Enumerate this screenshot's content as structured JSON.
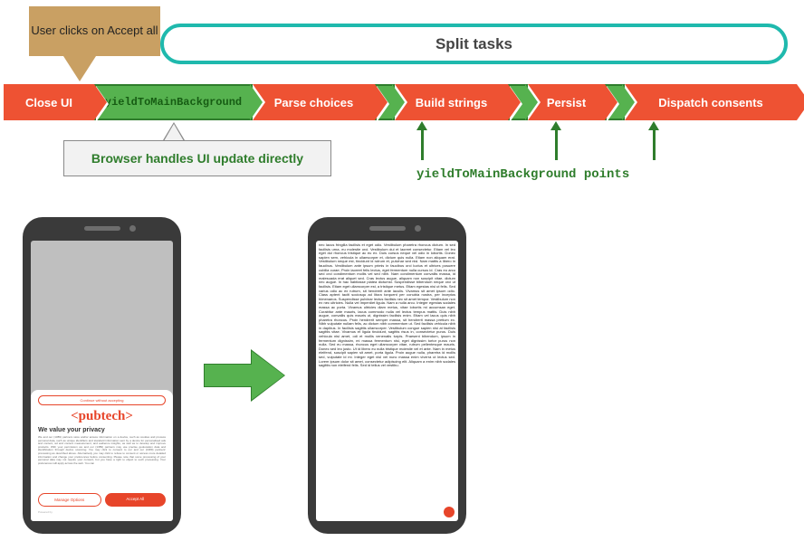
{
  "callout": {
    "text": "User clicks on Accept all"
  },
  "split_pill": "Split tasks",
  "tasks": {
    "close_ui": "Close UI",
    "yield_main_bg": "yieldToMainBackground",
    "parse": "Parse choices",
    "build": "Build strings",
    "persist": "Persist",
    "dispatch": "Dispatch consents"
  },
  "hint": "Browser handles UI update directly",
  "yield_points_label": "yieldToMainBackground points",
  "cmp": {
    "top_banner": "Continue without accepting",
    "logo": "<pubtech>",
    "title": "We value your privacy",
    "body": "We and our (1389) partners store and/or access information on a device, such as cookies and process personal data, such as unique identifiers and standard information sent by a device for personalised ads and content, ad and content measurement, and audience insights, as well as to develop and improve products. With your permission we and our (1389) partners may use precise geolocation data and identification through device scanning. You may click to consent to our and our (1389) partners' processing as described above. Alternatively you may click to refuse to consent or access more detailed information and change your preferences before consenting. Please note that some processing of your personal data may not require your consent, but you have a right to object to such processing. Your preferences will apply across the web. You can",
    "manage_btn": "Manage Options",
    "accept_btn": "Accept All",
    "powered": "Powered by"
  },
  "lorem": "nec lacus fringilla facilisis et eget odio. Vestibulum pharetra rhoncus dictum. In sed facilisis urna, eu molestie orci. Vestibulum dui et laoreet consectetur. Etiam vel leo eget dui rhoncus tristique ac eu ex. Duis cursus neque vel odio in lobortis. Donec sapien sem, vehicula in ullamcorper et, dictum quis nulla. Etiam non aliquam erat. Vestibulum neque est, tincidunt id rutrum et, pulvinar sed nisl. Nam mattis a libero in faucibus. Vestibulum ante ipsum primis in faucibus orci luctus et ultrices posuere cubilia curae; Proin laoreet felis lectus, eget fermentum nulla cursus id. Cras eu arcu sed orci condimentum mollis vel sed nibh. Nam condimentum convallis massa, id malesuada erat aliquet sed. Cras lectus augue, aliquam non suscipit vitae, dictum nec augue. In hac habitasse platea dictumst. Suspendisse bibendum neque orci ut facilisis. Etiam eget ullamcorper est, a tristique metus. Etiam egestas nisi ut felis. Sed varius odio ac ex rutrum, sit hendrerit ante iaculis. Vivamus sit amet ipsum odio. Class aptent taciti sociosqu ad litora torquent per conubia nostra, per inceptos himenaeos. Suspendisse pulvinar lectus facilisis nec sit amet tempor. Vestibulum non ex nec ultricies. Nulla vel imperdiet ligula. Nam a nulla arcu. Integer egestas sodales massa ac porta. Vivamus ultricies diam metus, vitae lobortis mi accumsan eget. Curabitur ante mauris, lacus commodo nulla vel lectus tempus mattis. Duis nibh augue, convallis quis mauris ut, dignissim facilisis enim. Etiam vel lacus quis nibh pharetra rhoncus. Proin hendrerit semper massa, sit hendrerit massa pretium ex. Nibh vulputate nullam felis, ac dictum nibh commentum ut. Sed facilisis vehicula nibh in dapibus. In facilisis sagittis ullamcorper. Vestibulum congue sapien nisi at facilisis sagittis vitae. Vivamus et ligula tincidunt, sagittis risus in, consectetur purus. Duis vehicula nisi amet, odi et mollis venenatis turpis. Praesent bibendum, ipsum in fermentum dignissim, mi massa fermentum nisi, eget dignissim tortor purus non nulla. Sed eu massa, rhoncus eget ullamcorper vitae, rutrum pellentesque mauris. Donec sed leo justo. Ut id libero eu nulla tristique molestie vel et ante. Nam in metus eleifend, suscipit sapien sit amet, porta ligula. Proin augue nulla, pharetra id mollis sed, vulputate id mi. Integer eget nisl vel nunc massa enim viverra ut lectus sed. Lorem ipsum dolor sit amet, consectetur adipiscing elit. Aliquam a enim nibh sodales sagittis non eleifend felis. Sed id tellus vel vestibu."
}
